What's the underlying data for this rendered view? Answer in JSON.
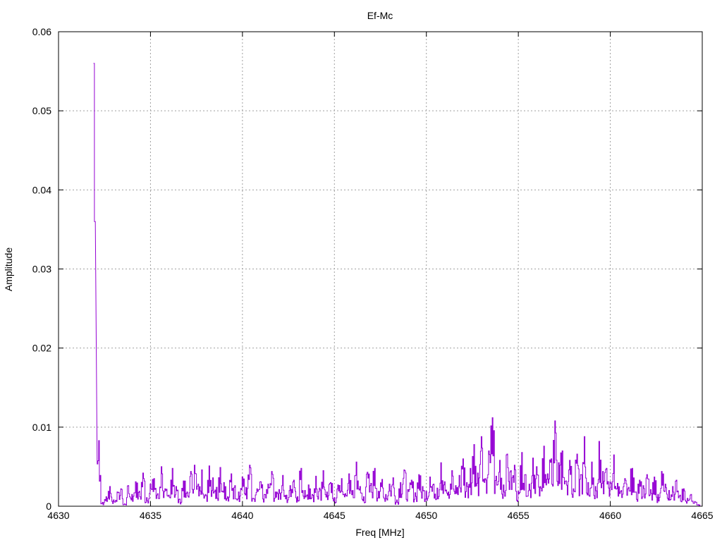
{
  "chart_data": {
    "type": "line",
    "style": "steps",
    "title": "Ef-Mc",
    "xlabel": "Freq [MHz]",
    "ylabel": "Amplitude",
    "xlim": [
      4630,
      4665
    ],
    "ylim": [
      0,
      0.06
    ],
    "xticks": [
      "4630",
      "4635",
      "4640",
      "4645",
      "4650",
      "4655",
      "4660",
      "4665"
    ],
    "xtick_values": [
      4630,
      4635,
      4640,
      4645,
      4650,
      4655,
      4660,
      4665
    ],
    "yticks": [
      "0",
      "0.01",
      "0.02",
      "0.03",
      "0.04",
      "0.05",
      "0.06"
    ],
    "ytick_values": [
      0,
      0.01,
      0.02,
      0.03,
      0.04,
      0.05,
      0.06
    ],
    "grid": true,
    "legend": "none",
    "series": [
      {
        "name": "Ef-Mc",
        "color": "#9400d3",
        "x_start": 4631.9,
        "x_step": 0.2,
        "values": [
          0.056,
          0.0083,
          0.0005,
          0.0012,
          0.0025,
          0.0008,
          0.0018,
          0.0022,
          0.0003,
          0.0026,
          0.0015,
          0.0031,
          0.0019,
          0.0042,
          0.0011,
          0.0028,
          0.0035,
          0.0016,
          0.005,
          0.0022,
          0.0014,
          0.0048,
          0.0025,
          0.0009,
          0.0032,
          0.0018,
          0.0044,
          0.0052,
          0.0028,
          0.0046,
          0.0015,
          0.0051,
          0.0036,
          0.0024,
          0.0049,
          0.003,
          0.0012,
          0.0041,
          0.0026,
          0.0018,
          0.0037,
          0.0024,
          0.0052,
          0.001,
          0.0022,
          0.0031,
          0.0015,
          0.0028,
          0.0044,
          0.0018,
          0.0021,
          0.0039,
          0.0014,
          0.0026,
          0.0033,
          0.0012,
          0.0048,
          0.002,
          0.0027,
          0.0015,
          0.0038,
          0.0023,
          0.0045,
          0.0018,
          0.003,
          0.0011,
          0.0027,
          0.0035,
          0.0016,
          0.0041,
          0.002,
          0.0056,
          0.0025,
          0.0012,
          0.0043,
          0.0029,
          0.0048,
          0.0019,
          0.0034,
          0.0015,
          0.0028,
          0.0036,
          0.0008,
          0.003,
          0.0046,
          0.0021,
          0.0033,
          0.0017,
          0.004,
          0.0025,
          0.0019,
          0.0037,
          0.0028,
          0.0023,
          0.0055,
          0.0031,
          0.0018,
          0.0045,
          0.0026,
          0.0039,
          0.006,
          0.003,
          0.0048,
          0.0078,
          0.0042,
          0.0088,
          0.0035,
          0.007,
          0.0112,
          0.0038,
          0.0058,
          0.0027,
          0.0066,
          0.0045,
          0.0052,
          0.0019,
          0.0068,
          0.004,
          0.0028,
          0.0061,
          0.005,
          0.0025,
          0.0076,
          0.0041,
          0.006,
          0.0108,
          0.0055,
          0.007,
          0.0032,
          0.0058,
          0.0022,
          0.0066,
          0.004,
          0.0088,
          0.003,
          0.0056,
          0.0025,
          0.0082,
          0.0044,
          0.0048,
          0.0031,
          0.0065,
          0.0029,
          0.002,
          0.0035,
          0.0024,
          0.0048,
          0.0018,
          0.0033,
          0.0026,
          0.004,
          0.0021,
          0.0037,
          0.0015,
          0.0044,
          0.0028,
          0.002,
          0.0025,
          0.0033,
          0.0014,
          0.0022,
          0.001,
          0.0015,
          0.0006,
          0.0002
        ]
      }
    ]
  }
}
